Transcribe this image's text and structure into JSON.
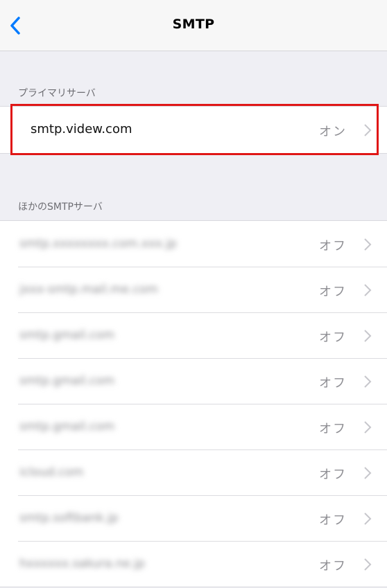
{
  "navbar": {
    "title": "SMTP"
  },
  "primary": {
    "header": "プライマリサーバ",
    "server": {
      "host": "smtp.videw.com",
      "status": "オン"
    }
  },
  "others": {
    "header": "ほかのSMTPサーバ",
    "servers": [
      {
        "host": "smtp.xxxxxxxx.com.xxx.jp",
        "status": "オフ"
      },
      {
        "host": "jxxx-smtp.mail.me.com",
        "status": "オフ"
      },
      {
        "host": "smtp.gmail.com",
        "status": "オフ"
      },
      {
        "host": "smtp.gmail.com",
        "status": "オフ"
      },
      {
        "host": "smtp.gmail.com",
        "status": "オフ"
      },
      {
        "host": "icloud.com",
        "status": "オフ"
      },
      {
        "host": "smtp.softbank.jp",
        "status": "オフ"
      },
      {
        "host": "hxxxxxx.sakura.ne.jp",
        "status": "オフ"
      }
    ]
  },
  "colors": {
    "accent": "#007aff",
    "highlight": "#e01616",
    "background": "#efeff4"
  }
}
